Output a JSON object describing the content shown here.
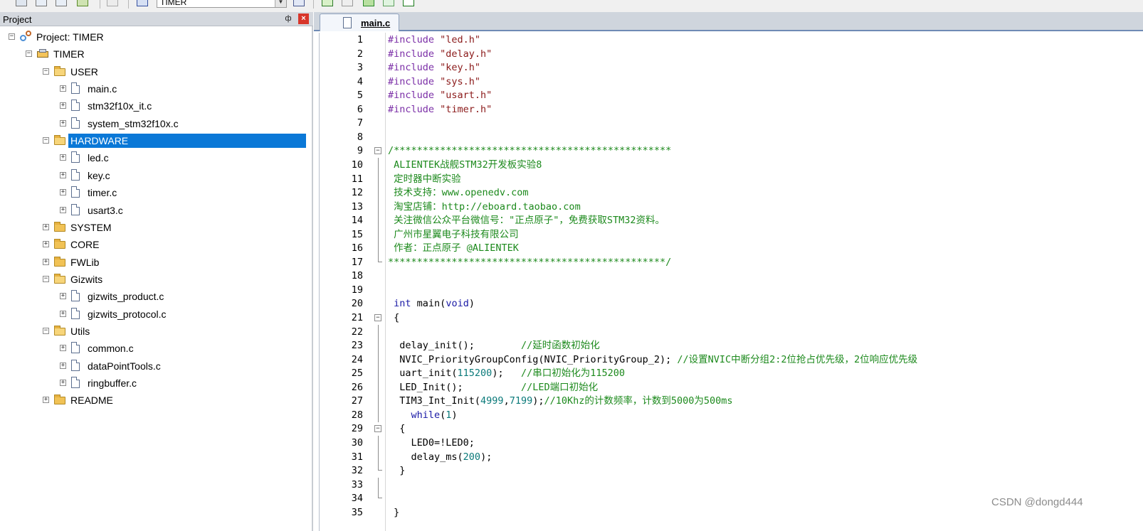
{
  "toolbar": {
    "target_selector": "TIMER"
  },
  "project_panel": {
    "title": "Project",
    "pin_glyph": "ф",
    "close_glyph": "×"
  },
  "tree": [
    {
      "label": "Project: TIMER",
      "icon": "project-icon",
      "toggle": "−",
      "level": 0
    },
    {
      "label": "TIMER",
      "icon": "target-icon",
      "toggle": "−",
      "level": 1
    },
    {
      "label": "USER",
      "icon": "folder-open-icon",
      "toggle": "−",
      "level": 2
    },
    {
      "label": "main.c",
      "icon": "file-icon",
      "toggle": "+",
      "level": 3
    },
    {
      "label": "stm32f10x_it.c",
      "icon": "file-icon",
      "toggle": "+",
      "level": 3
    },
    {
      "label": "system_stm32f10x.c",
      "icon": "file-icon",
      "toggle": "+",
      "level": 3
    },
    {
      "label": "HARDWARE",
      "icon": "folder-open-icon",
      "toggle": "−",
      "level": 2,
      "selected": true
    },
    {
      "label": "led.c",
      "icon": "file-icon",
      "toggle": "+",
      "level": 3
    },
    {
      "label": "key.c",
      "icon": "file-icon",
      "toggle": "+",
      "level": 3
    },
    {
      "label": "timer.c",
      "icon": "file-icon",
      "toggle": "+",
      "level": 3
    },
    {
      "label": "usart3.c",
      "icon": "file-icon",
      "toggle": "+",
      "level": 3
    },
    {
      "label": "SYSTEM",
      "icon": "folder-icon",
      "toggle": "+",
      "level": 2
    },
    {
      "label": "CORE",
      "icon": "folder-icon",
      "toggle": "+",
      "level": 2
    },
    {
      "label": "FWLib",
      "icon": "folder-icon",
      "toggle": "+",
      "level": 2
    },
    {
      "label": "Gizwits",
      "icon": "folder-open-icon",
      "toggle": "−",
      "level": 2
    },
    {
      "label": "gizwits_product.c",
      "icon": "file-icon",
      "toggle": "+",
      "level": 3
    },
    {
      "label": "gizwits_protocol.c",
      "icon": "file-icon",
      "toggle": "+",
      "level": 3
    },
    {
      "label": "Utils",
      "icon": "folder-open-icon",
      "toggle": "−",
      "level": 2
    },
    {
      "label": "common.c",
      "icon": "file-icon",
      "toggle": "+",
      "level": 3
    },
    {
      "label": "dataPointTools.c",
      "icon": "file-icon",
      "toggle": "+",
      "level": 3
    },
    {
      "label": "ringbuffer.c",
      "icon": "file-icon",
      "toggle": "+",
      "level": 3
    },
    {
      "label": "README",
      "icon": "folder-icon",
      "toggle": "+",
      "level": 2
    }
  ],
  "editor": {
    "tab_label": "main.c",
    "lines": [
      {
        "n": "1",
        "spans": [
          [
            "pp",
            "#include "
          ],
          [
            "str",
            "\"led.h\""
          ]
        ]
      },
      {
        "n": "2",
        "spans": [
          [
            "pp",
            "#include "
          ],
          [
            "str",
            "\"delay.h\""
          ]
        ]
      },
      {
        "n": "3",
        "spans": [
          [
            "pp",
            "#include "
          ],
          [
            "str",
            "\"key.h\""
          ]
        ]
      },
      {
        "n": "4",
        "spans": [
          [
            "pp",
            "#include "
          ],
          [
            "str",
            "\"sys.h\""
          ]
        ]
      },
      {
        "n": "5",
        "spans": [
          [
            "pp",
            "#include "
          ],
          [
            "str",
            "\"usart.h\""
          ]
        ]
      },
      {
        "n": "6",
        "spans": [
          [
            "pp",
            "#include "
          ],
          [
            "str",
            "\"timer.h\""
          ]
        ]
      },
      {
        "n": "7",
        "spans": []
      },
      {
        "n": "8",
        "spans": []
      },
      {
        "n": "9",
        "fold": "−",
        "spans": [
          [
            "cmt",
            "/************************************************"
          ]
        ]
      },
      {
        "n": "10",
        "fold_line": true,
        "spans": [
          [
            "cmt",
            " ALIENTEK战舰STM32开发板实验8"
          ]
        ]
      },
      {
        "n": "11",
        "fold_line": true,
        "spans": [
          [
            "cmt",
            " 定时器中断实验"
          ]
        ]
      },
      {
        "n": "12",
        "fold_line": true,
        "spans": [
          [
            "cmt",
            " 技术支持：www.openedv.com"
          ]
        ]
      },
      {
        "n": "13",
        "fold_line": true,
        "spans": [
          [
            "cmt",
            " 淘宝店铺：http://eboard.taobao.com"
          ]
        ]
      },
      {
        "n": "14",
        "fold_line": true,
        "spans": [
          [
            "cmt",
            " 关注微信公众平台微信号：\"正点原子\"，免费获取STM32资料。"
          ]
        ]
      },
      {
        "n": "15",
        "fold_line": true,
        "spans": [
          [
            "cmt",
            " 广州市星翼电子科技有限公司"
          ]
        ]
      },
      {
        "n": "16",
        "fold_line": true,
        "spans": [
          [
            "cmt",
            " 作者：正点原子 @ALIENTEK"
          ]
        ]
      },
      {
        "n": "17",
        "fold_end": true,
        "spans": [
          [
            "cmt",
            "************************************************/"
          ]
        ]
      },
      {
        "n": "18",
        "spans": []
      },
      {
        "n": "19",
        "spans": []
      },
      {
        "n": "20",
        "spans": [
          [
            "",
            " "
          ],
          [
            "kw",
            "int"
          ],
          [
            "",
            " main("
          ],
          [
            "kw",
            "void"
          ],
          [
            "",
            ")"
          ]
        ]
      },
      {
        "n": "21",
        "fold": "−",
        "spans": [
          [
            "",
            " {"
          ]
        ]
      },
      {
        "n": "22",
        "fold_line": true,
        "spans": []
      },
      {
        "n": "23",
        "fold_line": true,
        "spans": [
          [
            "",
            "  delay_init();        "
          ],
          [
            "cmt",
            "//延时函数初始化"
          ]
        ]
      },
      {
        "n": "24",
        "fold_line": true,
        "spans": [
          [
            "",
            "  NVIC_PriorityGroupConfig(NVIC_PriorityGroup_2); "
          ],
          [
            "cmt",
            "//设置NVIC中断分组2:2位抢占优先级，2位响应优先级"
          ]
        ]
      },
      {
        "n": "25",
        "fold_line": true,
        "spans": [
          [
            "",
            "  uart_init("
          ],
          [
            "num",
            "115200"
          ],
          [
            "",
            ");   "
          ],
          [
            "cmt",
            "//串口初始化为115200"
          ]
        ]
      },
      {
        "n": "26",
        "fold_line": true,
        "spans": [
          [
            "",
            "  LED_Init();          "
          ],
          [
            "cmt",
            "//LED端口初始化"
          ]
        ]
      },
      {
        "n": "27",
        "fold_line": true,
        "spans": [
          [
            "",
            "  TIM3_Int_Init("
          ],
          [
            "num",
            "4999"
          ],
          [
            "",
            ","
          ],
          [
            "num",
            "7199"
          ],
          [
            "",
            ");"
          ],
          [
            "cmt",
            "//10Khz的计数频率，计数到5000为500ms"
          ]
        ]
      },
      {
        "n": "28",
        "fold_line": true,
        "spans": [
          [
            "",
            "    "
          ],
          [
            "kw",
            "while"
          ],
          [
            "",
            "("
          ],
          [
            "num",
            "1"
          ],
          [
            "",
            ")"
          ]
        ]
      },
      {
        "n": "29",
        "fold": "−",
        "spans": [
          [
            "",
            "  {"
          ]
        ]
      },
      {
        "n": "30",
        "fold_line": true,
        "spans": [
          [
            "",
            "    LED0=!LED0;"
          ]
        ]
      },
      {
        "n": "31",
        "fold_line": true,
        "spans": [
          [
            "",
            "    delay_ms("
          ],
          [
            "num",
            "200"
          ],
          [
            "",
            ");"
          ]
        ]
      },
      {
        "n": "32",
        "fold_end": true,
        "spans": [
          [
            "",
            "  }"
          ]
        ]
      },
      {
        "n": "33",
        "fold_line": true,
        "spans": []
      },
      {
        "n": "34",
        "fold_end": true,
        "spans": []
      },
      {
        "n": "35",
        "spans": [
          [
            "",
            " }"
          ]
        ]
      }
    ]
  },
  "watermark": "CSDN @dongd444"
}
